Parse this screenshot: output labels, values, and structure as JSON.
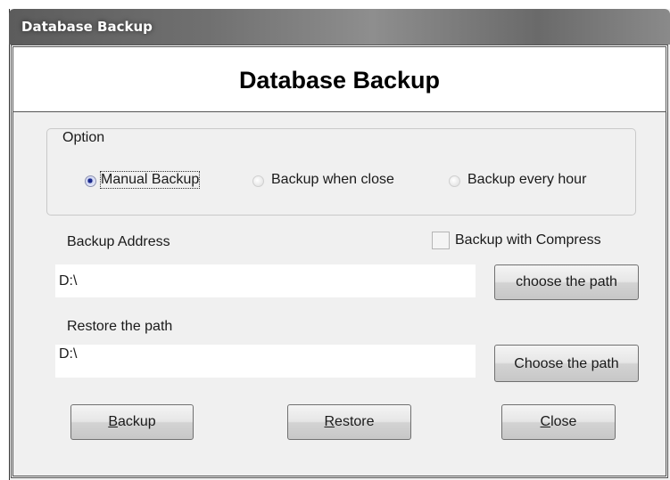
{
  "window": {
    "title": "Database Backup"
  },
  "header": {
    "title": "Database Backup"
  },
  "option_group": {
    "legend": "Option",
    "options": [
      {
        "label": "Manual Backup",
        "selected": true
      },
      {
        "label": "Backup when close",
        "selected": false
      },
      {
        "label": "Backup every hour",
        "selected": false
      }
    ]
  },
  "backup": {
    "address_label": "Backup Address",
    "compress_label": "Backup with Compress",
    "compress_checked": false,
    "address_value": "D:\\",
    "choose_button": "choose the path"
  },
  "restore": {
    "path_label": "Restore the path",
    "path_value": "D:\\",
    "choose_button": "Choose the path"
  },
  "actions": {
    "backup": {
      "mnemonic": "B",
      "rest": "ackup"
    },
    "restore": {
      "mnemonic": "R",
      "rest": "estore"
    },
    "close": {
      "mnemonic": "C",
      "rest": "lose"
    }
  }
}
